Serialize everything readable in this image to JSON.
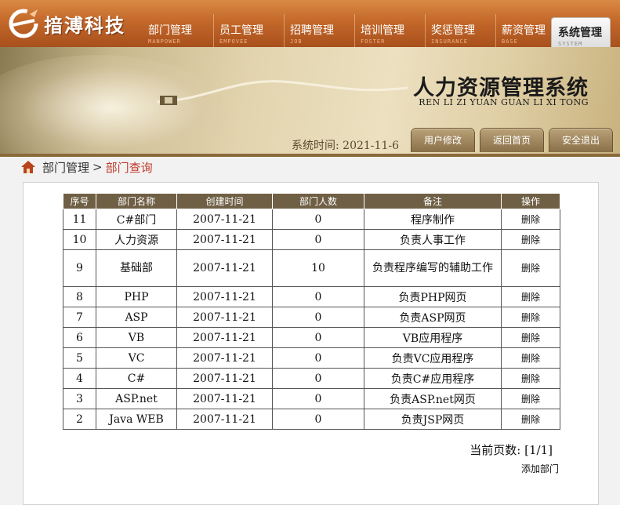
{
  "header": {
    "logo_text": "揞溥科技",
    "nav": [
      {
        "label": "部门管理",
        "sub": "MANPOWER"
      },
      {
        "label": "员工管理",
        "sub": "EMPOVEE"
      },
      {
        "label": "招聘管理",
        "sub": "JOB"
      },
      {
        "label": "培训管理",
        "sub": "FOSTER"
      },
      {
        "label": "奖惩管理",
        "sub": "INSURANCE"
      },
      {
        "label": "薪资管理",
        "sub": "BASE"
      },
      {
        "label": "系统管理",
        "sub": "SYSTEM",
        "active": true
      }
    ]
  },
  "banner": {
    "title": "人力资源管理系统",
    "subtitle": "REN LI ZI YUAN GUAN LI XI TONG",
    "time_label": "系统时间:",
    "time_value": "2021-11-6",
    "buttons": [
      "用户修改",
      "返回首页",
      "安全退出"
    ]
  },
  "breadcrumb": {
    "parent": "部门管理",
    "separator": ">",
    "current": "部门查询"
  },
  "table": {
    "columns": [
      "序号",
      "部门名称",
      "创建时间",
      "部门人数",
      "备注",
      "操作"
    ],
    "rows": [
      {
        "id": "11",
        "name": "C#部门",
        "created": "2007-11-21",
        "count": "0",
        "remark": "程序制作",
        "action": "删除"
      },
      {
        "id": "10",
        "name": "人力资源",
        "created": "2007-11-21",
        "count": "0",
        "remark": "负责人事工作",
        "action": "删除"
      },
      {
        "id": "9",
        "name": "基础部",
        "created": "2007-11-21",
        "count": "10",
        "remark": "负责程序编写的辅助工作",
        "action": "删除"
      },
      {
        "id": "8",
        "name": "PHP",
        "created": "2007-11-21",
        "count": "0",
        "remark": "负责PHP网页",
        "action": "删除"
      },
      {
        "id": "7",
        "name": "ASP",
        "created": "2007-11-21",
        "count": "0",
        "remark": "负责ASP网页",
        "action": "删除"
      },
      {
        "id": "6",
        "name": "VB",
        "created": "2007-11-21",
        "count": "0",
        "remark": "VB应用程序",
        "action": "删除"
      },
      {
        "id": "5",
        "name": "VC",
        "created": "2007-11-21",
        "count": "0",
        "remark": "负责VC应用程序",
        "action": "删除"
      },
      {
        "id": "4",
        "name": "C#",
        "created": "2007-11-21",
        "count": "0",
        "remark": "负责C#应用程序",
        "action": "删除"
      },
      {
        "id": "3",
        "name": "ASP.net",
        "created": "2007-11-21",
        "count": "0",
        "remark": "负责ASP.net网页",
        "action": "删除"
      },
      {
        "id": "2",
        "name": "Java WEB",
        "created": "2007-11-21",
        "count": "0",
        "remark": "负责JSP网页",
        "action": "删除"
      }
    ]
  },
  "pager": {
    "label": "当前页数:",
    "value": "[1/1]"
  },
  "add_link": "添加部门",
  "colors": {
    "nav_orange": "#c4682a",
    "table_header": "#6f5f45",
    "breadcrumb_current": "#c0392b"
  }
}
